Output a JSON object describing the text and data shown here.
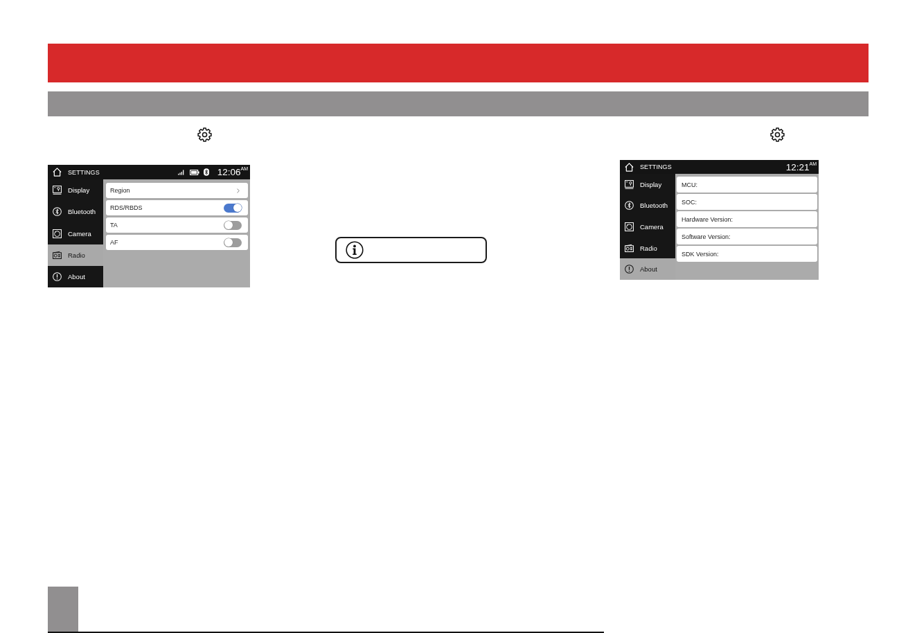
{
  "screens": [
    {
      "title": "SETTINGS",
      "status_icons": true,
      "time": "12:06$^{AM}$",
      "sidebar": [
        {
          "label": "Display",
          "kind": "display",
          "selected": false
        },
        {
          "label": "Bluetooth",
          "kind": "bluetooth",
          "selected": false
        },
        {
          "label": "Camera",
          "kind": "camera",
          "selected": false
        },
        {
          "label": "Radio",
          "kind": "radio",
          "selected": true
        },
        {
          "label": "About",
          "kind": "about",
          "selected": false
        }
      ],
      "rows": [
        {
          "label": "Region",
          "kind": "link"
        },
        {
          "label": "RDS/RBDS",
          "kind": "toggle",
          "on": true
        },
        {
          "label": "TA",
          "kind": "toggle",
          "on": false
        },
        {
          "label": "AF",
          "kind": "toggle",
          "on": false
        }
      ]
    },
    {
      "title": "SETTINGS",
      "status_icons": false,
      "time": "12:21$^{AM}$",
      "sidebar": [
        {
          "label": "Display",
          "kind": "display",
          "selected": false
        },
        {
          "label": "Bluetooth",
          "kind": "bluetooth",
          "selected": false
        },
        {
          "label": "Camera",
          "kind": "camera",
          "selected": false
        },
        {
          "label": "Radio",
          "kind": "radio",
          "selected": false
        },
        {
          "label": "About",
          "kind": "about",
          "selected": true
        }
      ],
      "rows": [
        {
          "label": "MCU:",
          "kind": "info"
        },
        {
          "label": "SOC:",
          "kind": "info"
        },
        {
          "label": "Hardware Version:",
          "kind": "info"
        },
        {
          "label": "Software Version:",
          "kind": "info"
        },
        {
          "label": "SDK Version:",
          "kind": "info"
        }
      ]
    }
  ]
}
